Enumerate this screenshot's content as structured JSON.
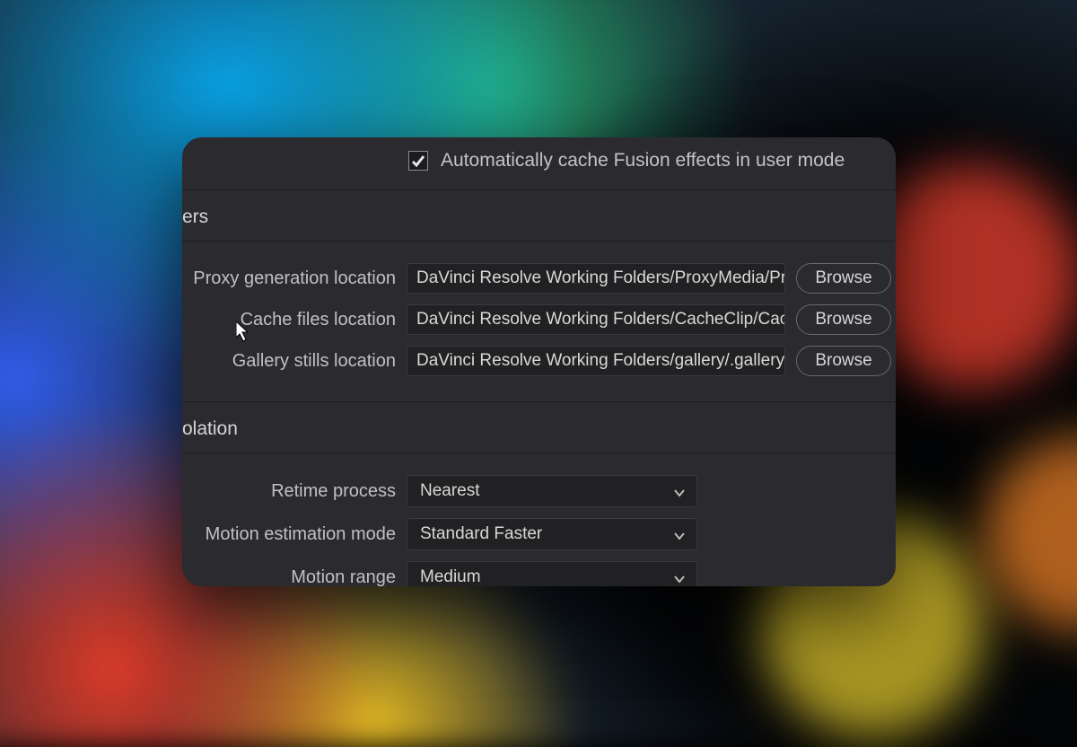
{
  "topCheckbox": {
    "label": "Automatically cache Fusion effects in user mode",
    "checked": true
  },
  "sections": {
    "workingFolders": {
      "heading": "Working Folders",
      "fragment": "ers",
      "rows": [
        {
          "label": "Proxy generation location",
          "value": "DaVinci Resolve Working Folders/ProxyMedia/ProxyMedia",
          "browse": "Browse"
        },
        {
          "label": "Cache files location",
          "value": "DaVinci Resolve Working Folders/CacheClip/CacheClip",
          "browse": "Browse"
        },
        {
          "label": "Gallery stills location",
          "value": "DaVinci Resolve Working Folders/gallery/.gallery",
          "browse": "Browse"
        }
      ]
    },
    "frameInterpolation": {
      "heading": "Frame Interpolation",
      "fragment": "olation",
      "rows": [
        {
          "label": "Retime process",
          "value": "Nearest"
        },
        {
          "label": "Motion estimation mode",
          "value": "Standard Faster"
        },
        {
          "label": "Motion range",
          "value": "Medium"
        }
      ]
    }
  }
}
